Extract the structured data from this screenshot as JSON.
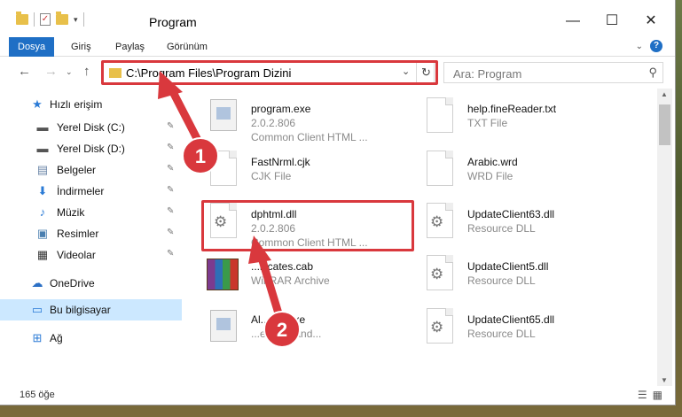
{
  "window": {
    "title": "Program"
  },
  "ribbon": {
    "tabs": [
      "Dosya",
      "Giriş",
      "Paylaş",
      "Görünüm"
    ]
  },
  "nav": {
    "address": "C:\\Program Files\\Program Dizini",
    "search_placeholder": "Ara: Program"
  },
  "sidebar": {
    "items": [
      {
        "label": "Hızlı erişim",
        "icon": "star-icon"
      },
      {
        "label": "Yerel Disk (C:)",
        "icon": "drive-icon"
      },
      {
        "label": "Yerel Disk (D:)",
        "icon": "drive-icon"
      },
      {
        "label": "Belgeler",
        "icon": "documents-icon"
      },
      {
        "label": "İndirmeler",
        "icon": "download-icon"
      },
      {
        "label": "Müzik",
        "icon": "music-icon"
      },
      {
        "label": "Resimler",
        "icon": "pictures-icon"
      },
      {
        "label": "Videolar",
        "icon": "video-icon"
      },
      {
        "label": "OneDrive",
        "icon": "cloud-icon"
      },
      {
        "label": "Bu bilgisayar",
        "icon": "computer-icon"
      },
      {
        "label": "Ağ",
        "icon": "network-icon"
      }
    ]
  },
  "files": [
    {
      "name": "program.exe",
      "line2": "2.0.2.806",
      "line3": "Common Client HTML ..."
    },
    {
      "name": "help.fineReader.txt",
      "line2": "TXT File",
      "line3": ""
    },
    {
      "name": "FastNrml.cjk",
      "line2": "CJK File",
      "line3": ""
    },
    {
      "name": "Arabic.wrd",
      "line2": "WRD File",
      "line3": ""
    },
    {
      "name": "dphtml.dll",
      "line2": "2.0.2.806",
      "line3": "Common Client HTML ..."
    },
    {
      "name": "UpdateClient63.dll",
      "line2": "Resource DLL",
      "line3": ""
    },
    {
      "name": "...ificates.cab",
      "line2": "WinRAR Archive",
      "line3": ""
    },
    {
      "name": "UpdateClient5.dll",
      "line2": "Resource DLL",
      "line3": ""
    },
    {
      "name": "Al...ATI.exe",
      "line2": "...event hand...",
      "line3": ""
    },
    {
      "name": "UpdateClient65.dll",
      "line2": "Resource DLL",
      "line3": ""
    }
  ],
  "status": {
    "count": "165 öğe"
  },
  "annotations": {
    "badge1": "1",
    "badge2": "2",
    "accent": "#d9383d"
  }
}
